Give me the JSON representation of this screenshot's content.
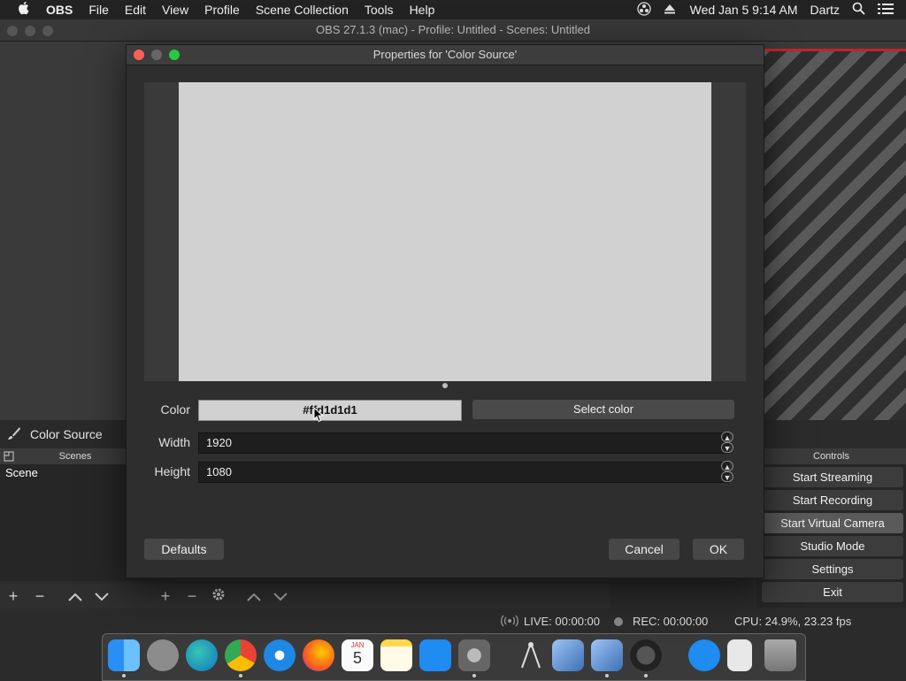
{
  "menubar": {
    "app_name": "OBS",
    "items": [
      "File",
      "Edit",
      "View",
      "Profile",
      "Scene Collection",
      "Tools",
      "Help"
    ],
    "clock": "Wed Jan 5  9:14 AM",
    "user": "Dartz"
  },
  "main_window": {
    "title": "OBS 27.1.3 (mac) - Profile: Untitled - Scenes: Untitled"
  },
  "dialog": {
    "title": "Properties for 'Color Source'",
    "color_label": "Color",
    "color_value": "#ffd1d1d1",
    "select_color_label": "Select color",
    "width_label": "Width",
    "width_value": "1920",
    "height_label": "Height",
    "height_value": "1080",
    "defaults_label": "Defaults",
    "cancel_label": "Cancel",
    "ok_label": "OK",
    "preview_color": "#d1d1d1"
  },
  "sources": {
    "selected_source": "Color Source"
  },
  "scenes": {
    "title": "Scenes",
    "items": [
      "Scene"
    ]
  },
  "controls": {
    "title": "Controls",
    "buttons": [
      "Start Streaming",
      "Start Recording",
      "Start Virtual Camera",
      "Studio Mode",
      "Settings",
      "Exit"
    ]
  },
  "status": {
    "live": "LIVE: 00:00:00",
    "rec": "REC: 00:00:00",
    "cpu": "CPU: 24.9%, 23.23 fps"
  },
  "dock_apps": [
    "finder-icon",
    "launchpad-icon",
    "edge-icon",
    "chrome-icon",
    "safari-icon",
    "firefox-icon",
    "calendar-icon",
    "notes-icon",
    "app-store-icon",
    "system-preferences-icon",
    "compass-icon",
    "virtualbox-icon",
    "virtualbox-icon",
    "obs-icon",
    "app-store-icon",
    "document-icon",
    "trash-icon"
  ],
  "calendar": {
    "month": "JAN",
    "day": "5"
  },
  "colors": {
    "traffic_red": "#fe5f57",
    "traffic_yellow": "#febc2e",
    "traffic_green": "#28c840",
    "recording_red": "#c2232b"
  }
}
